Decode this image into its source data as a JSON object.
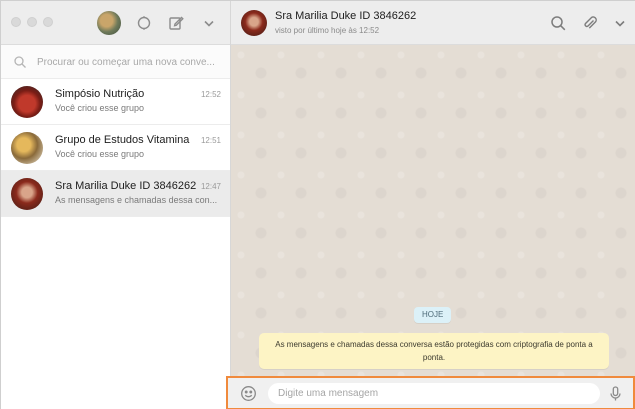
{
  "sidebar": {
    "search_placeholder": "Procurar ou começar uma nova conve...",
    "chats": [
      {
        "name": "Simpósio Nutrição",
        "time": "12:52",
        "preview": "Você criou esse grupo"
      },
      {
        "name": "Grupo de Estudos Vitamina",
        "time": "12:51",
        "preview": "Você criou esse grupo"
      },
      {
        "name": "Sra Marilia Duke ID 3846262",
        "time": "12:47",
        "preview": "As mensagens e chamadas dessa con..."
      }
    ],
    "icons": {
      "refresh": "status-icon",
      "compose": "new-chat-icon",
      "menu": "chevron-down-icon"
    }
  },
  "conversation": {
    "contact_name": "Sra Marilia Duke ID 3846262",
    "contact_status": "visto por último hoje às 12:52",
    "date_label": "HOJE",
    "encryption_notice": "As mensagens e chamadas dessa conversa estão protegidas com criptografia de ponta a ponta.",
    "icons": {
      "search": "search-icon",
      "attach": "paperclip-icon",
      "menu": "chevron-down-icon"
    }
  },
  "composer": {
    "placeholder": "Digite uma mensagem",
    "icons": {
      "emoji": "emoji-icon",
      "mic": "mic-icon"
    },
    "highlight_color": "#f08a3c"
  },
  "colors": {
    "header_bg": "#ededed",
    "chat_bg": "#e4ddd4",
    "notice_bg": "#fdf4c5",
    "date_bg": "#dcf1f8"
  }
}
